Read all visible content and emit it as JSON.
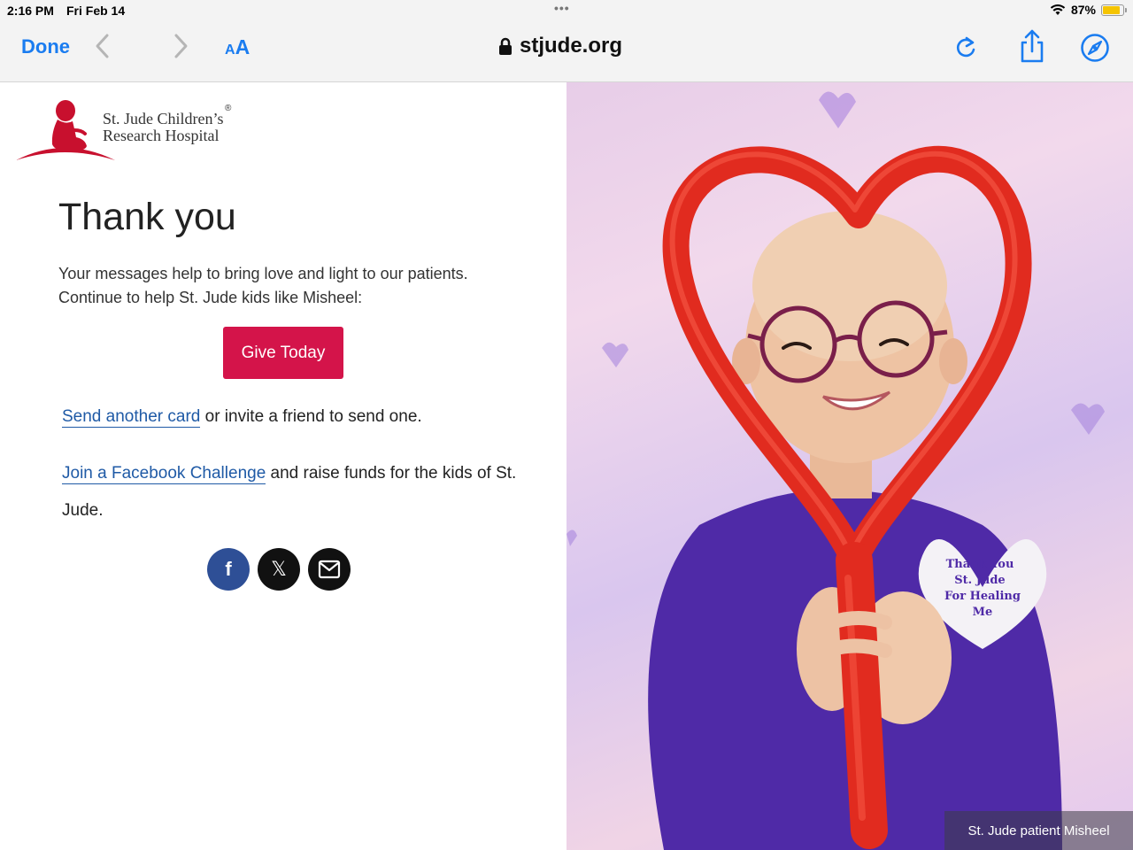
{
  "status_bar": {
    "time": "2:16 PM",
    "date": "Fri Feb 14",
    "battery_percent": "87%",
    "battery_level": 0.87
  },
  "toolbar": {
    "done_label": "Done",
    "text_size_small": "A",
    "text_size_large": "A",
    "url": "stjude.org",
    "icons": [
      "chevron-left-icon",
      "chevron-right-icon",
      "lock-icon",
      "reload-icon",
      "share-icon",
      "compass-icon"
    ]
  },
  "logo": {
    "line1": "St. Jude Children’s",
    "line2": "Research Hospital",
    "registered": "®"
  },
  "content": {
    "heading": "Thank you",
    "intro_line1": "Your messages help to bring love and light to our patients.",
    "intro_line2": "Continue to help St. Jude kids like Misheel:",
    "give_button": "Give Today",
    "send_card_link": "Send another card",
    "send_card_rest": " or invite a friend to send one.",
    "facebook_link": "Join a Facebook Challenge",
    "facebook_rest": " and raise funds for the kids of St. Jude."
  },
  "socials": {
    "facebook_glyph": "f",
    "x_glyph": "𝕏"
  },
  "photo": {
    "shirt_text": [
      "Thank You",
      "St. Jude",
      "For Healing",
      "Me"
    ],
    "caption": "St. Jude patient Misheel"
  },
  "colors": {
    "accent_blue": "#1a7cf0",
    "give_red": "#d4144a",
    "link_blue": "#1f5aa6",
    "logo_red": "#c8102e",
    "facebook_blue": "#2e4f96"
  }
}
